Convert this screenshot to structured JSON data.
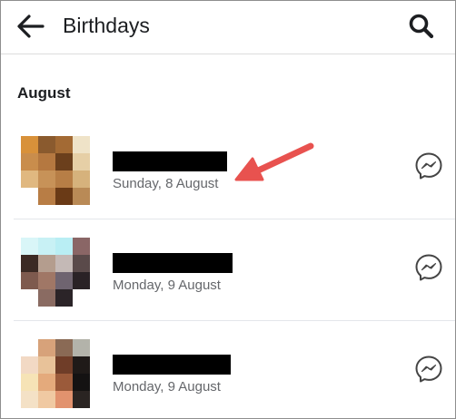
{
  "header": {
    "title": "Birthdays"
  },
  "section": {
    "title": "August"
  },
  "birthdays": [
    {
      "name": "",
      "date": "Sunday, 8 August"
    },
    {
      "name": "",
      "date": "Monday, 9 August"
    },
    {
      "name": "",
      "date": "Monday, 9 August"
    }
  ],
  "icons": {
    "back": "arrow-left-icon",
    "search": "search-icon",
    "message": "messenger-icon",
    "annotation": "red-arrow-annotation"
  },
  "colors": {
    "annotation_arrow": "#e8524f",
    "text_primary": "#1c1e21",
    "text_secondary": "#65676b",
    "redaction": "#000000"
  }
}
